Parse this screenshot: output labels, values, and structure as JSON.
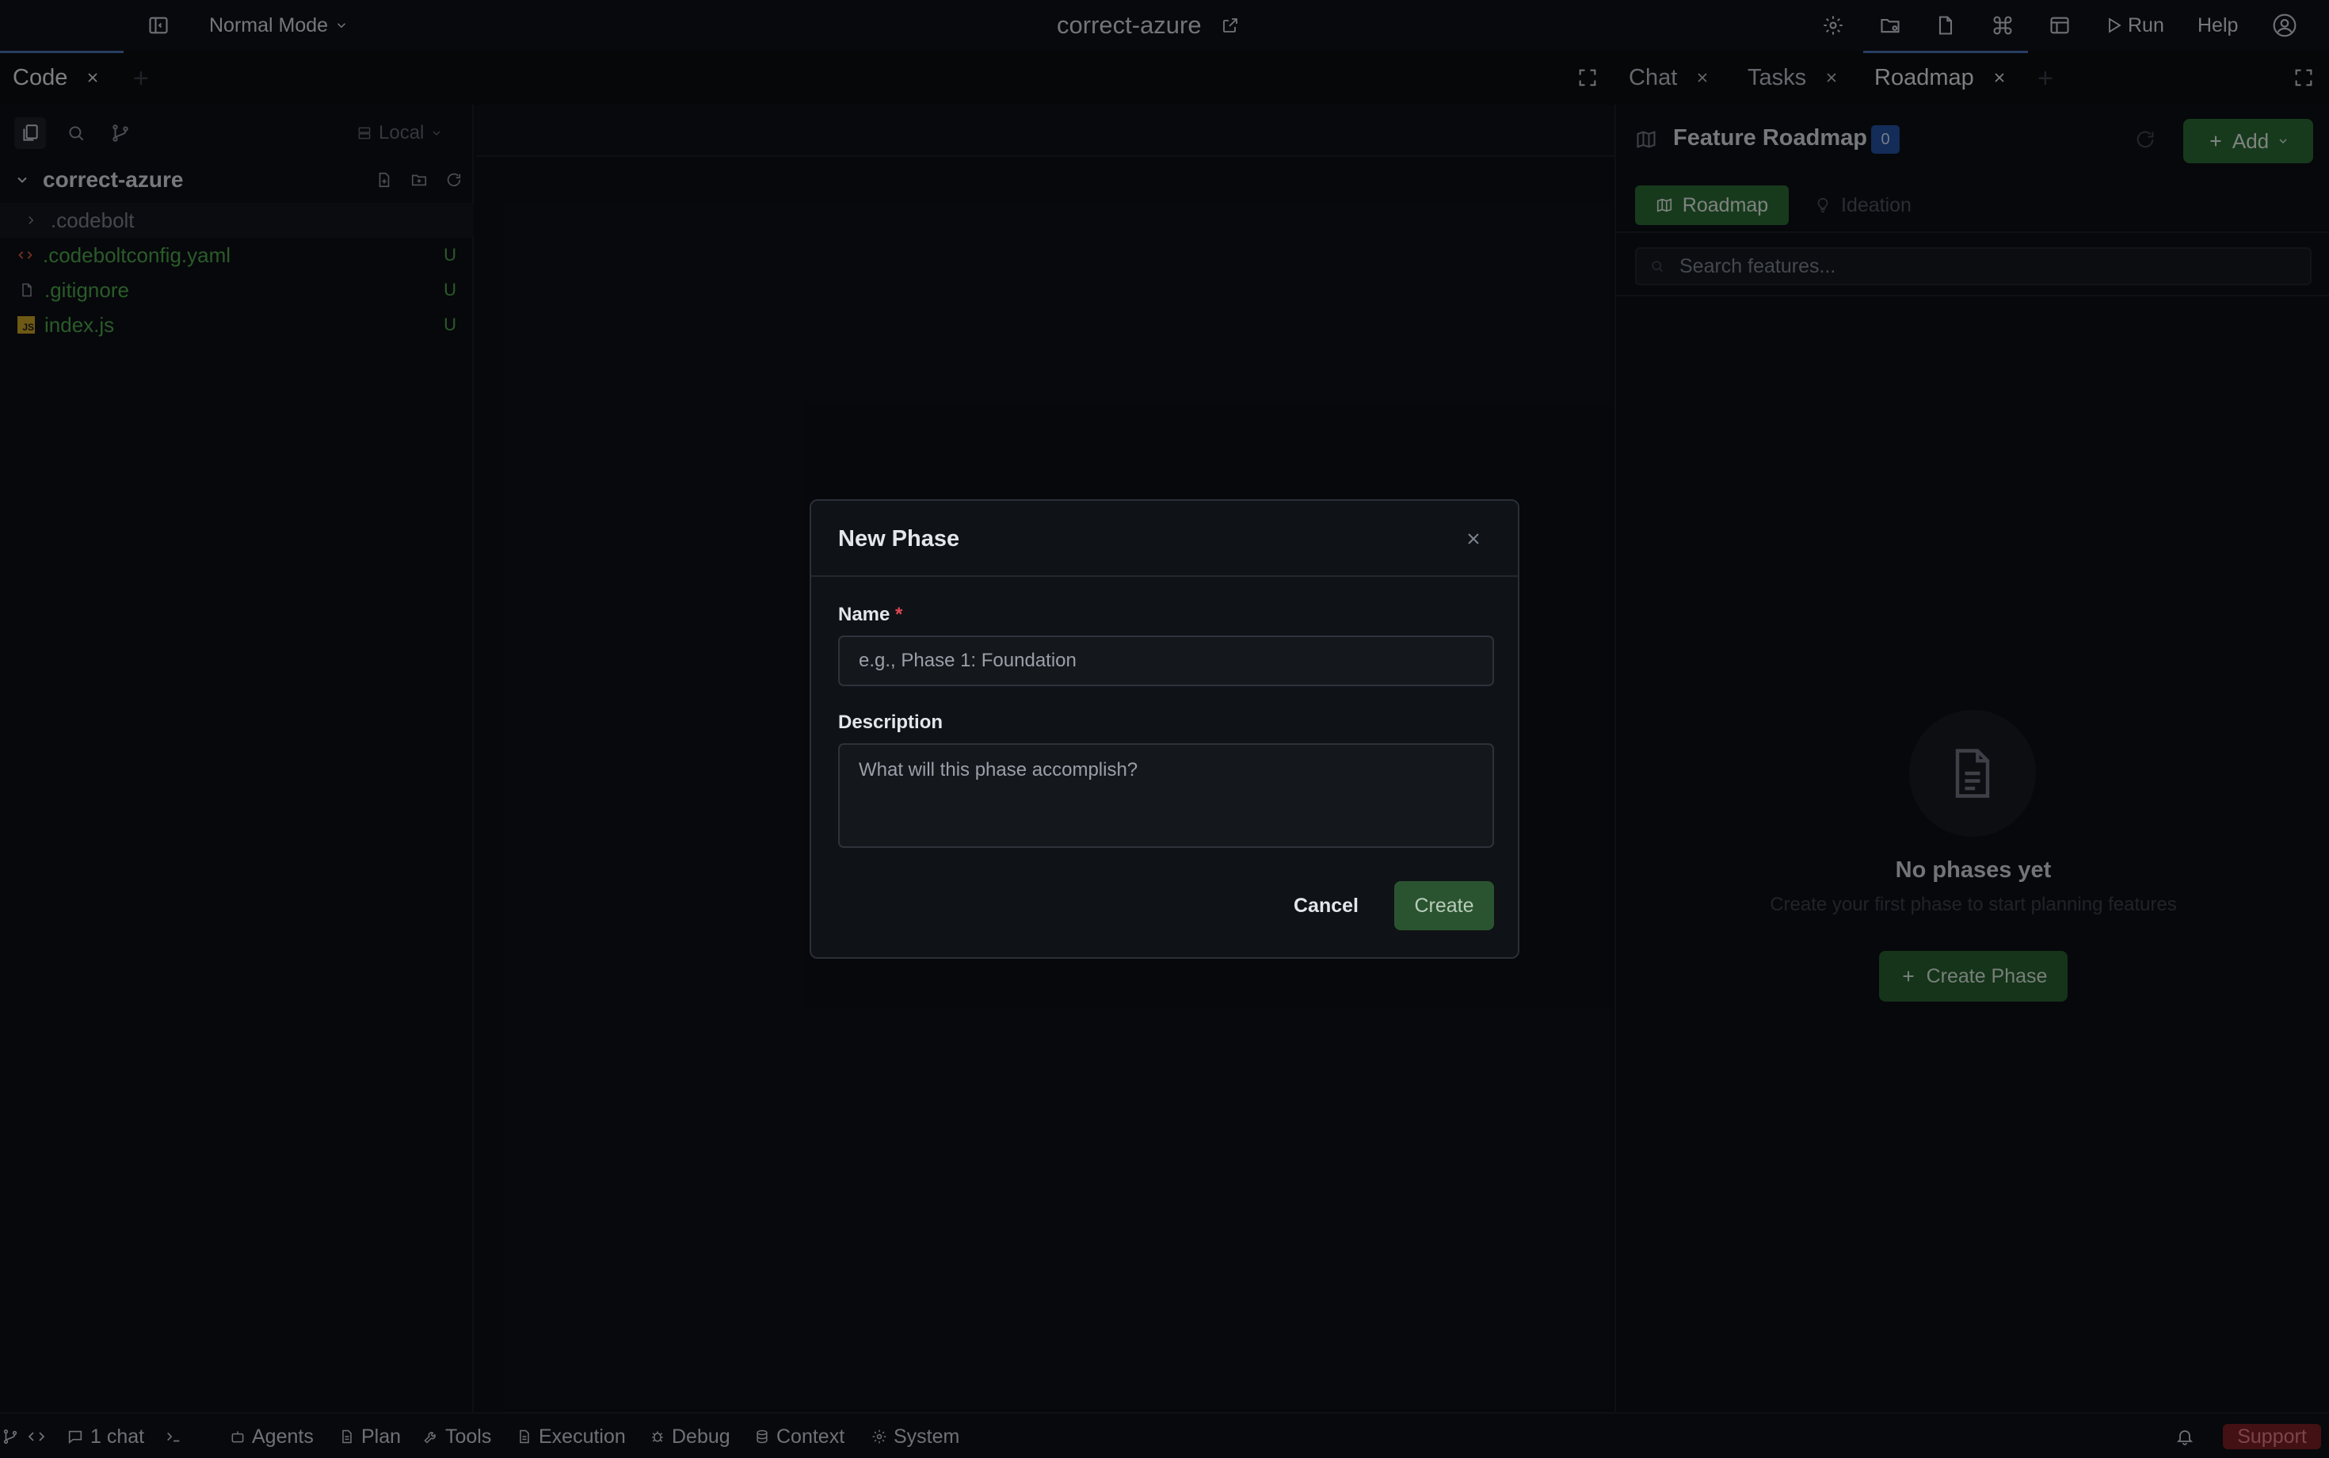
{
  "topbar": {
    "mode_label": "Normal Mode",
    "project_title": "correct-azure",
    "run_label": "Run",
    "help_label": "Help"
  },
  "tabs": {
    "left": [
      {
        "label": "Code"
      }
    ],
    "right": [
      {
        "label": "Chat"
      },
      {
        "label": "Tasks"
      },
      {
        "label": "Roadmap"
      }
    ]
  },
  "explorer": {
    "location": "Local",
    "root": "correct-azure",
    "items": [
      {
        "name": ".codebolt",
        "kind": "folder",
        "status": ""
      },
      {
        "name": ".codeboltconfig.yaml",
        "kind": "code-file",
        "status": "U"
      },
      {
        "name": ".gitignore",
        "kind": "file",
        "status": "U"
      },
      {
        "name": "index.js",
        "kind": "js-file",
        "status": "U"
      }
    ]
  },
  "roadmap": {
    "title": "Feature Roadmap",
    "count": "0",
    "add_label": "Add",
    "tab_roadmap": "Roadmap",
    "tab_ideation": "Ideation",
    "search_placeholder": "Search features...",
    "empty_title": "No phases yet",
    "empty_subtitle": "Create your first phase to start planning features",
    "create_phase_label": "Create Phase"
  },
  "modal": {
    "title": "New Phase",
    "name_label": "Name",
    "required_mark": "*",
    "name_placeholder": "e.g., Phase 1: Foundation",
    "description_label": "Description",
    "description_placeholder": "What will this phase accomplish?",
    "cancel_label": "Cancel",
    "create_label": "Create"
  },
  "statusbar": {
    "chat_count": "1 chat",
    "items": [
      "Agents",
      "Plan",
      "Tools",
      "Execution",
      "Debug",
      "Context",
      "System"
    ],
    "support_label": "Support"
  },
  "colors": {
    "background": "#0d1015",
    "accent_green": "#2a6b35",
    "badge_blue": "#2450a0",
    "git_untracked": "#4ea64e",
    "support_red": "#7a1f25"
  }
}
